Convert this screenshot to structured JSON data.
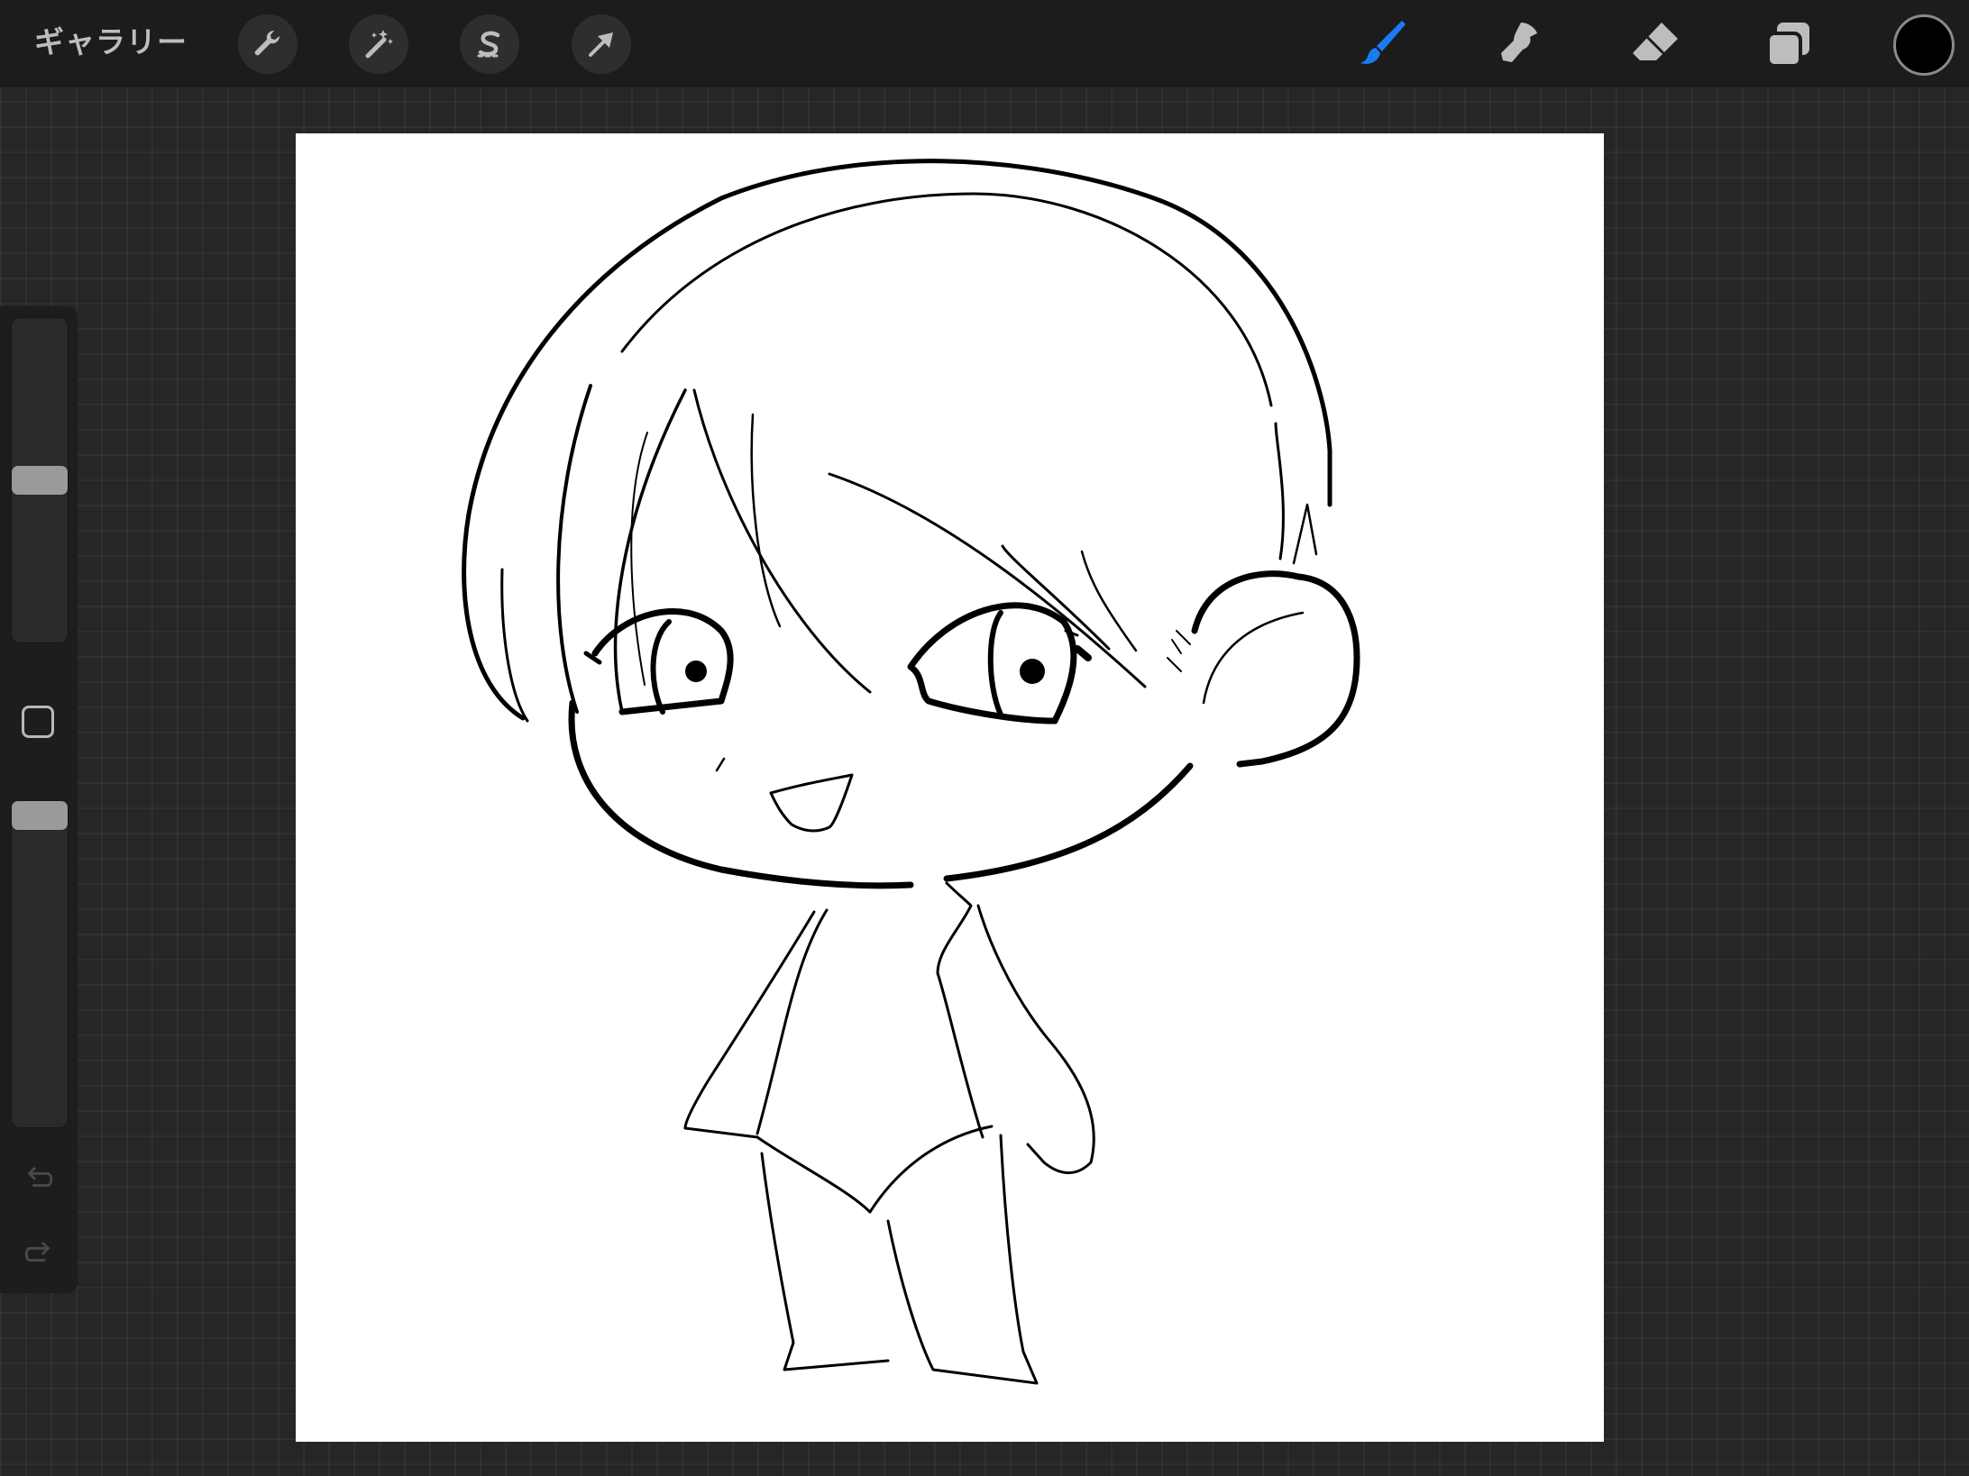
{
  "topbar": {
    "gallery_label": "ギャラリー",
    "left_tools": [
      {
        "name": "actions-wrench-icon"
      },
      {
        "name": "adjustments-magic-wand-icon"
      },
      {
        "name": "selection-s-icon"
      },
      {
        "name": "transform-arrow-icon"
      }
    ],
    "right_tools": [
      {
        "name": "brush-icon",
        "active": true
      },
      {
        "name": "smudge-icon",
        "active": false
      },
      {
        "name": "eraser-icon",
        "active": false
      },
      {
        "name": "layers-icon",
        "active": false
      }
    ],
    "active_color": "#000000",
    "accent_color": "#1a7cf5"
  },
  "sidebar": {
    "brush_size_level": 0.5,
    "opacity_level": 0.0,
    "modify_button": "modify-square-icon",
    "undo_icon": "undo-icon",
    "redo_icon": "redo-icon"
  },
  "canvas": {
    "background": "#ffffff",
    "drawing": "chibi-character-lineart"
  }
}
